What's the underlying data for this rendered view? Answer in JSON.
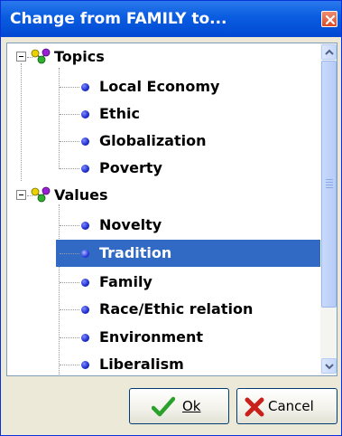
{
  "window": {
    "title": "Change from FAMILY to..."
  },
  "tree": {
    "categories": [
      {
        "label": "Topics",
        "items": [
          "Local Economy",
          "Ethic",
          "Globalization",
          "Poverty"
        ]
      },
      {
        "label": "Values",
        "items": [
          "Novelty",
          "Tradition",
          "Family",
          "Race/Ethic relation",
          "Environment",
          "Liberalism"
        ]
      }
    ],
    "selected_item": "Tradition"
  },
  "buttons": {
    "ok_label": "Ok",
    "cancel_label": "Cancel"
  },
  "colors": {
    "titlebar": "#0a5ce0",
    "selection": "#316ac5",
    "bullet": "#2233d0",
    "ok_check": "#2aa12a",
    "cancel_x": "#c8201a"
  },
  "icons": {
    "category": "molecule-icon",
    "item": "blue-bullet-icon",
    "ok": "checkmark-icon",
    "cancel": "red-x-icon"
  }
}
